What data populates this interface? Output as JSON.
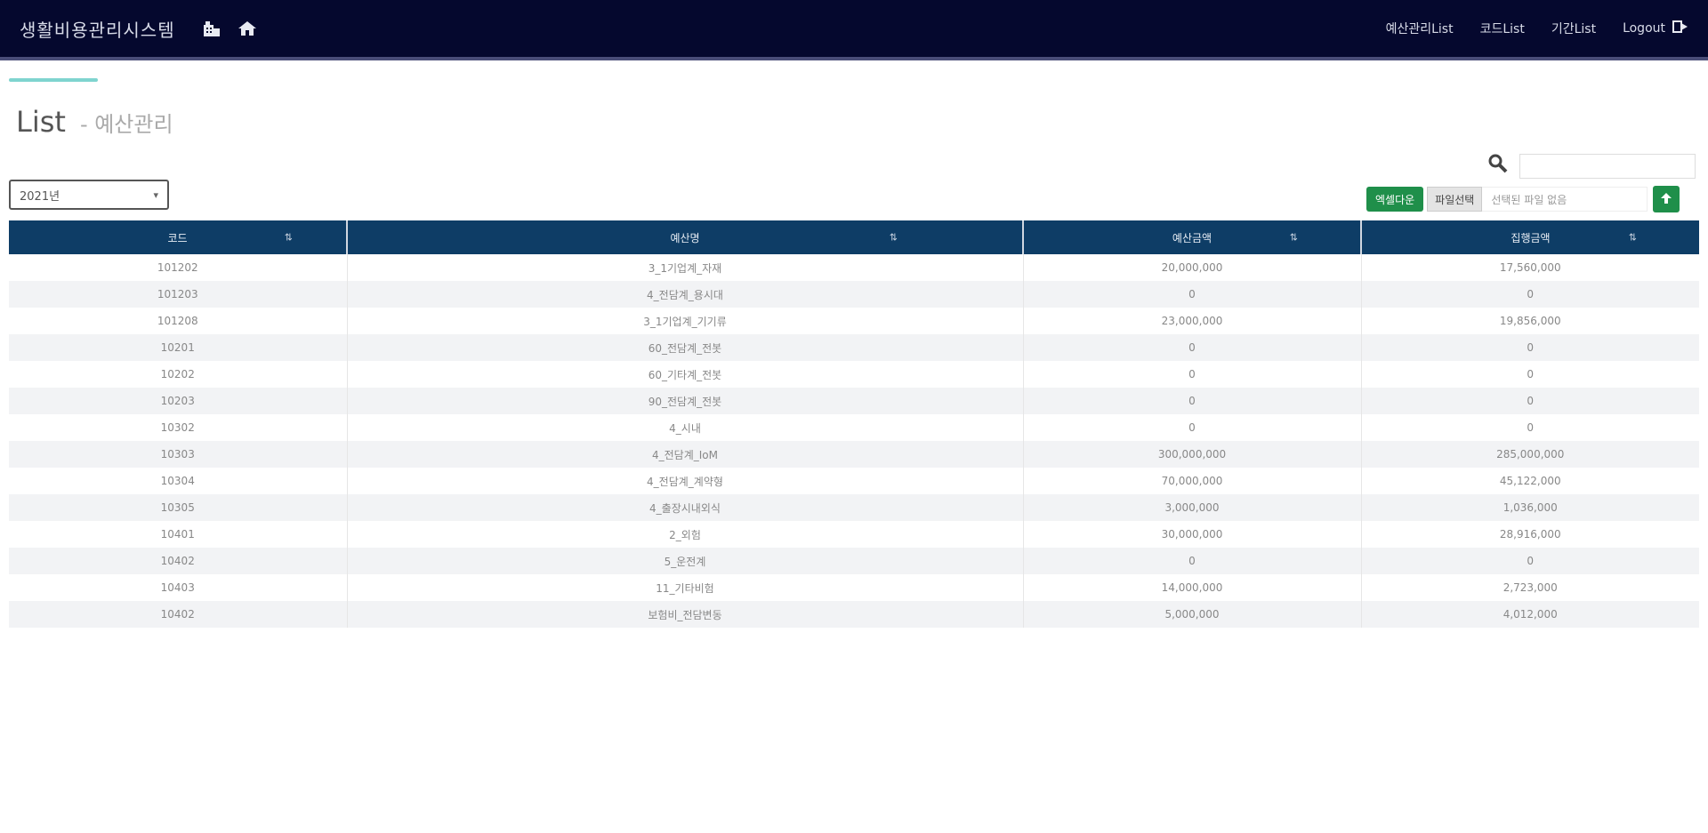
{
  "navbar": {
    "brand": "생활비용관리시스템",
    "icons": [
      "building-icon",
      "home-icon"
    ],
    "links": [
      "예산관리List",
      "코드List",
      "기간List"
    ],
    "logout_label": "Logout",
    "logout_icon": "exit-icon",
    "bg_color": "#05082e"
  },
  "page": {
    "title": "List",
    "subtitle": "- 예산관리"
  },
  "filter": {
    "year_selected": "2021년"
  },
  "toolbar": {
    "excel_button": "엑셀다운",
    "file_button": "파일선택",
    "file_placeholder": "선택된 파일 없음",
    "upload_icon": "upload-icon"
  },
  "table": {
    "columns": [
      "코드",
      "예산명",
      "예산금액",
      "집행금액"
    ],
    "rows": [
      [
        "101202",
        "3_1기업계_자재",
        "20,000,000",
        "17,560,000"
      ],
      [
        "101203",
        "4_전담계_용시대",
        "0",
        "0"
      ],
      [
        "101208",
        "3_1기업계_기기류",
        "23,000,000",
        "19,856,000"
      ],
      [
        "10201",
        "60_전담계_전봇",
        "0",
        "0"
      ],
      [
        "10202",
        "60_기타계_전봇",
        "0",
        "0"
      ],
      [
        "10203",
        "90_전담계_전봇",
        "0",
        "0"
      ],
      [
        "10302",
        "4_시내",
        "0",
        "0"
      ],
      [
        "10303",
        "4_전담계_IoM",
        "300,000,000",
        "285,000,000"
      ],
      [
        "10304",
        "4_전담계_계약형",
        "70,000,000",
        "45,122,000"
      ],
      [
        "10305",
        "4_출장시내외식",
        "3,000,000",
        "1,036,000"
      ],
      [
        "10401",
        "2_외험",
        "30,000,000",
        "28,916,000"
      ],
      [
        "10402",
        "5_운전계",
        "0",
        "0"
      ],
      [
        "10403",
        "11_기타비험",
        "14,000,000",
        "2,723,000"
      ],
      [
        "10402",
        "보험비_전담변동",
        "5,000,000",
        "4,012,000"
      ]
    ]
  }
}
